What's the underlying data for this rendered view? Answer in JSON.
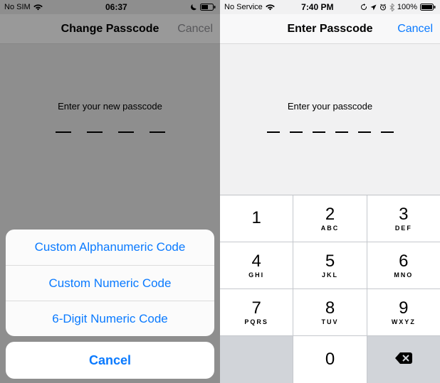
{
  "left": {
    "status": {
      "carrier": "No SIM",
      "time": "06:37"
    },
    "nav": {
      "title": "Change Passcode",
      "cancel": "Cancel"
    },
    "prompt": "Enter your new passcode",
    "dash_count": 4,
    "sheet": {
      "options": [
        "Custom Alphanumeric Code",
        "Custom Numeric Code",
        "6-Digit Numeric Code"
      ],
      "cancel": "Cancel"
    }
  },
  "right": {
    "status": {
      "carrier": "No Service",
      "time": "7:40 PM",
      "battery_pct": "100%"
    },
    "nav": {
      "title": "Enter Passcode",
      "cancel": "Cancel"
    },
    "prompt": "Enter your passcode",
    "dash_count": 6,
    "keypad": [
      {
        "digit": "1",
        "letters": ""
      },
      {
        "digit": "2",
        "letters": "ABC"
      },
      {
        "digit": "3",
        "letters": "DEF"
      },
      {
        "digit": "4",
        "letters": "GHI"
      },
      {
        "digit": "5",
        "letters": "JKL"
      },
      {
        "digit": "6",
        "letters": "MNO"
      },
      {
        "digit": "7",
        "letters": "PQRS"
      },
      {
        "digit": "8",
        "letters": "TUV"
      },
      {
        "digit": "9",
        "letters": "WXYZ"
      },
      {
        "digit": "0",
        "letters": ""
      }
    ]
  }
}
